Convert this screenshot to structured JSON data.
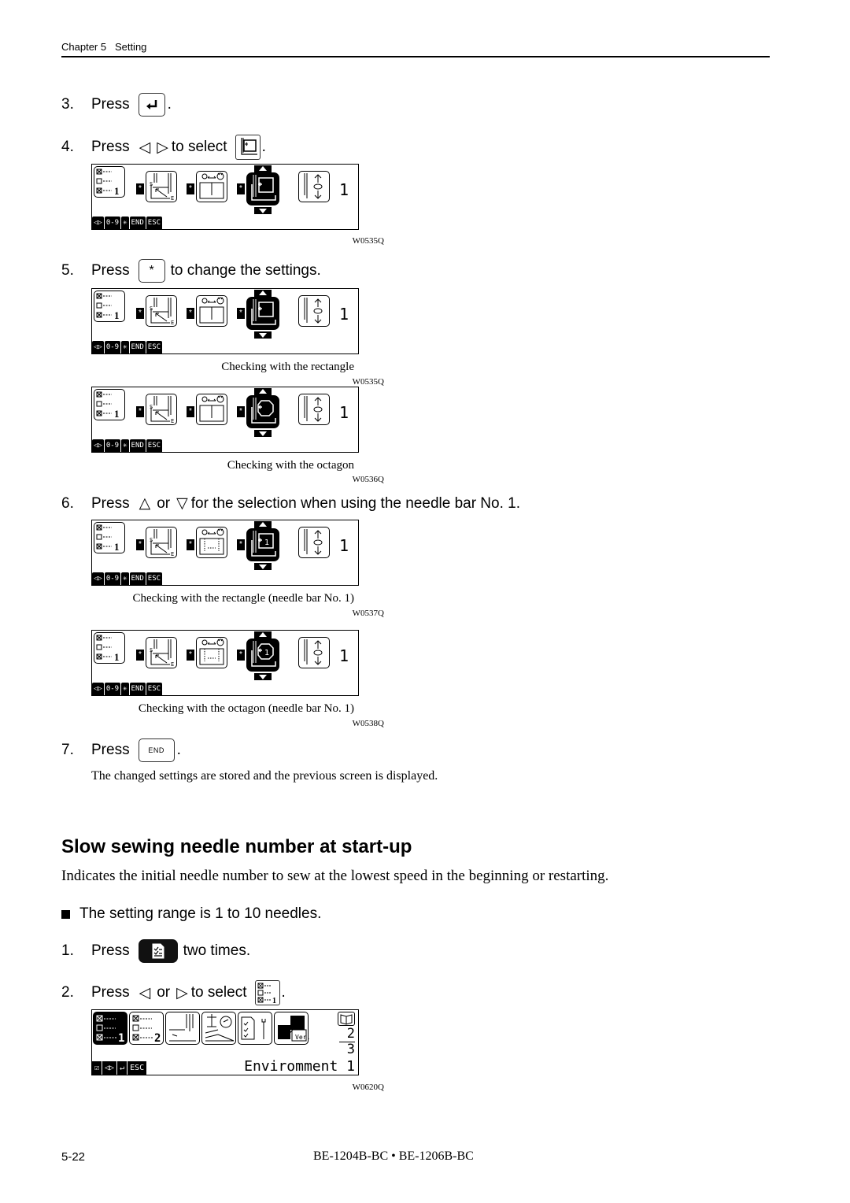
{
  "header": {
    "chapter": "Chapter 5",
    "section": "Setting"
  },
  "steps_a": [
    {
      "num": "3.",
      "word": "Press",
      "key": "enter-key",
      "after": "."
    },
    {
      "num": "4.",
      "word": "Press",
      "arrows": [
        "◁",
        "▷"
      ],
      "middle": "to select",
      "after": "."
    },
    {
      "num": "5.",
      "word": "Press",
      "key_label": "*",
      "after": "to change the settings."
    },
    {
      "num": "6.",
      "word": "Press",
      "arrows": [
        "△",
        "▽"
      ],
      "or": "or",
      "after": "for the selection when using the needle bar No. 1."
    },
    {
      "num": "7.",
      "word": "Press",
      "key_label": "END",
      "after": "."
    }
  ],
  "lcd_common": {
    "softkeys": [
      "◁▷",
      "0-9",
      "✳",
      "END",
      "ESC"
    ],
    "value": "1"
  },
  "figures": [
    {
      "code": "W0535Q",
      "caption": "",
      "variant": "rectangle"
    },
    {
      "code": "W0535Q",
      "caption": "Checking with the rectangle",
      "variant": "rectangle"
    },
    {
      "code": "W0536Q",
      "caption": "Checking with the octagon",
      "variant": "octagon"
    },
    {
      "code": "W0537Q",
      "caption": "Checking with the rectangle (needle bar No. 1)",
      "variant": "rectangle-1"
    },
    {
      "code": "W0538Q",
      "caption": "Checking with the octagon (needle bar No. 1)",
      "variant": "octagon-1"
    }
  ],
  "step7_note": "The changed settings are stored and the previous screen is displayed.",
  "section": {
    "title": "Slow sewing needle number at start-up",
    "description": "Indicates the initial needle number to sew at the lowest speed in the beginning or restarting.",
    "bullet": "The setting range is 1 to 10 needles.",
    "steps": [
      {
        "num": "1.",
        "word": "Press",
        "after": "two times."
      },
      {
        "num": "2.",
        "word": "Press",
        "arrows": [
          "◁",
          "▷"
        ],
        "or": "or",
        "middle": "to select",
        "after": "."
      }
    ]
  },
  "lcd2": {
    "softkeys": [
      "☑",
      "◁▷",
      "↵",
      "ESC"
    ],
    "pages": [
      "2",
      "3"
    ],
    "label": "Enviromment 1",
    "code": "W0620Q"
  },
  "footer": {
    "page": "5-22",
    "model": "BE-1204B-BC • BE-1206B-BC"
  }
}
